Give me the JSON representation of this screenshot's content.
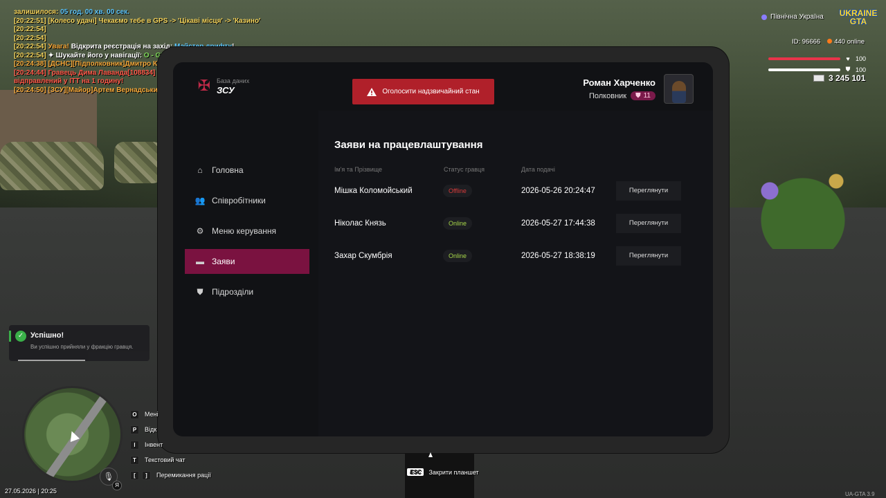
{
  "chat": [
    {
      "parts": [
        {
          "t": "залишилося:",
          "c": "yellow"
        },
        {
          "t": " 05 год. 00 хв. 00 сек.",
          "c": "cyan"
        }
      ]
    },
    {
      "parts": [
        {
          "t": "[20:22:51] [Колесо удачі] Чекаємо тебе в GPS -> 'Цікаві місця' -> 'Казино'",
          "c": "yellow"
        }
      ]
    },
    {
      "parts": [
        {
          "t": "[20:22:54]",
          "c": "yellow"
        }
      ]
    },
    {
      "parts": [
        {
          "t": "[20:22:54]",
          "c": "yellow"
        }
      ]
    },
    {
      "parts": [
        {
          "t": "[20:22:54] ",
          "c": "yellow"
        },
        {
          "t": "Увага!",
          "c": "orange"
        },
        {
          "t": " Відкрита реєстрація на захід: ",
          "c": "white"
        },
        {
          "t": "Майстер дрифту",
          "c": "cyan"
        },
        {
          "t": "!",
          "c": "white"
        }
      ]
    },
    {
      "parts": [
        {
          "t": "[20:22:54] ",
          "c": "yellow"
        },
        {
          "t": "✦ Шукайте його у навігації: ",
          "c": "white"
        },
        {
          "t": "O - GPS - Цікаві місця - Арена",
          "c": "green"
        }
      ]
    },
    {
      "parts": [
        {
          "t": "[20:24:38] [ДСНС][Підполковник]Дмитро Кортік [109365]:",
          "c": "orange"
        },
        {
          "t": " ЗСУ зв''язок",
          "c": "white"
        }
      ]
    },
    {
      "parts": [
        {
          "t": "[20:24:44] Гравець Дима Лаванда[108834] вийшов під час затримання і був",
          "c": "red"
        }
      ]
    },
    {
      "parts": [
        {
          "t": " відправлений у ІТТ на 1 годину!",
          "c": "red"
        }
      ]
    },
    {
      "parts": [
        {
          "t": "[20:24:50] [ЗСУ][Майор]Артем Вернадський [105916]:",
          "c": "orange"
        },
        {
          "t": " на зв'язку",
          "c": "white"
        }
      ]
    }
  ],
  "hud": {
    "region": "Північна Україна",
    "brand_top": "UKRAINE",
    "brand_bottom": "GTA",
    "id_label": "ID: 96666",
    "online": "440 online",
    "health": "100",
    "armor": "100",
    "money": "3 245 101",
    "health_color": "#e8344a",
    "armor_color": "#ffffff"
  },
  "tablet": {
    "db_label": "База даних",
    "org_label": "ЗСУ",
    "alarm_button": "Оголосити надзвичайний стан",
    "user_name": "Роман Харченко",
    "user_rank": "Полковник",
    "rank_level": "11",
    "nav": [
      {
        "label": "Головна",
        "icon": "home-icon"
      },
      {
        "label": "Співробітники",
        "icon": "users-icon"
      },
      {
        "label": "Меню керування",
        "icon": "gear-icon"
      },
      {
        "label": "Заяви",
        "icon": "folder-icon"
      },
      {
        "label": "Підрозділи",
        "icon": "shield-icon"
      }
    ],
    "active_nav": "Заяви",
    "page_title": "Заяви на працевлаштування",
    "columns": [
      "Ім'я та Прізвище",
      "Статус гравця",
      "Дата подачі"
    ],
    "rows": [
      {
        "name": "Мішка Коломойський",
        "status": "Offline",
        "date": "2026-05-26 20:24:47",
        "action": "Переглянути"
      },
      {
        "name": "Ніколас Князь",
        "status": "Online",
        "date": "2026-05-27 17:44:38",
        "action": "Переглянути"
      },
      {
        "name": "Захар Скумбрія",
        "status": "Online",
        "date": "2026-05-27 18:38:19",
        "action": "Переглянути"
      }
    ],
    "accent_color": "#7a1240",
    "alarm_color": "#b0202a"
  },
  "toast": {
    "title": "Успішно!",
    "message": "Ви успішно прийняли у фракцію гравця.",
    "progress": 0.55
  },
  "hints": [
    {
      "key": "O",
      "label": "Мені"
    },
    {
      "key": "P",
      "label": "Відк"
    },
    {
      "key": "I",
      "label": "Інвент"
    },
    {
      "key": "T",
      "label": "Текстовий чат"
    },
    {
      "keys": [
        "[",
        "]"
      ],
      "label": "Перемикання рації"
    }
  ],
  "esc": {
    "key": "ESC",
    "label": "Закрити планшет"
  },
  "language": "Я",
  "datetime": "27.05.2026 | 20:25",
  "version": "UA-GTA 3.9"
}
